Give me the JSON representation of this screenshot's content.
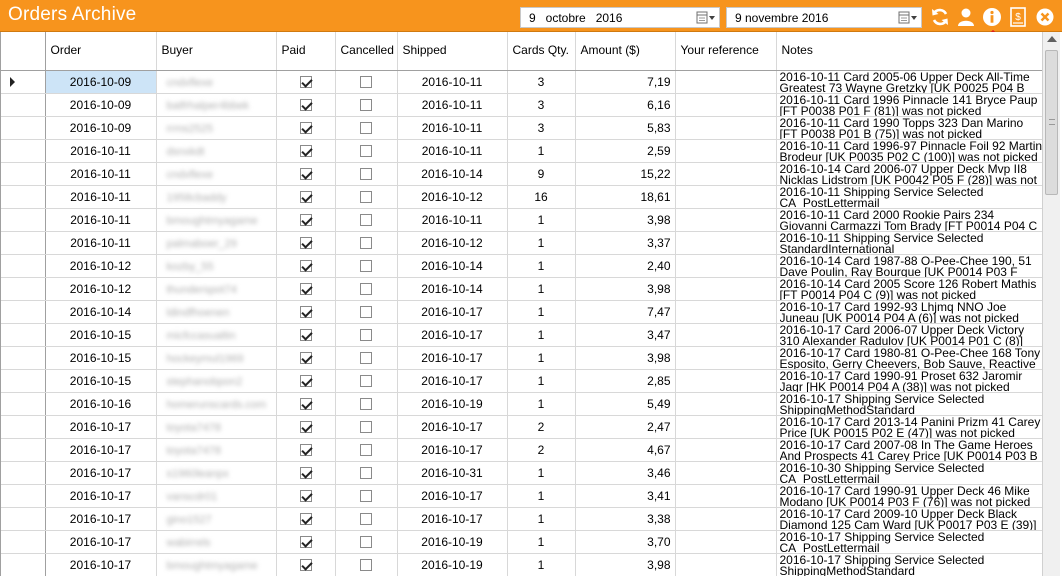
{
  "window": {
    "title": "Orders Archive",
    "date_from": "9   octobre   2016",
    "date_to": "9 novembre 2016",
    "buttons": {
      "refresh": "refresh-icon",
      "user": "user-icon",
      "info": "info-icon",
      "export": "export-icon",
      "close": "close-icon"
    },
    "accent_color": "#f7941d"
  },
  "columns": {
    "order": "Order",
    "buyer": "Buyer",
    "paid": "Paid",
    "cancelled": "Cancelled",
    "shipped": "Shipped",
    "qty": "Cards Qty.",
    "amount": "Amount ($)",
    "reference": "Your reference",
    "notes": "Notes"
  },
  "rows": [
    {
      "order": "2016-10-09",
      "buyer": "cndxflexe",
      "paid": true,
      "cancelled": false,
      "shipped": "2016-10-11",
      "qty": "3",
      "amount": "7,19",
      "notes": "2016-10-11 Card 2005-06 Upper Deck All-Time Greatest 73 Wayne Gretzky [UK P0025 P04 B (82)]"
    },
    {
      "order": "2016-10-09",
      "buyer": "batfrhalper4bbek",
      "paid": true,
      "cancelled": false,
      "shipped": "2016-10-11",
      "qty": "3",
      "amount": "6,16",
      "notes": "2016-10-11 Card 1996 Pinnacle  141 Bryce Paup [FT P0038 P01 F (81)] was not picked"
    },
    {
      "order": "2016-10-09",
      "buyer": "rrms2525",
      "paid": true,
      "cancelled": false,
      "shipped": "2016-10-11",
      "qty": "3",
      "amount": "5,83",
      "notes": "2016-10-11 Card 1990 Topps  323 Dan Marino [FT P0038 P01 B (75)] was not picked"
    },
    {
      "order": "2016-10-11",
      "buyer": "dsnxkdt",
      "paid": true,
      "cancelled": false,
      "shipped": "2016-10-11",
      "qty": "1",
      "amount": "2,59",
      "notes": "2016-10-11 Card 1996-97 Pinnacle Foil  92 Martin Brodeur [UK P0035 P02 C (100)] was not picked"
    },
    {
      "order": "2016-10-11",
      "buyer": "cndxflexe",
      "paid": true,
      "cancelled": false,
      "shipped": "2016-10-14",
      "qty": "9",
      "amount": "15,22",
      "notes": "2016-10-14 Card 2006-07 Upper Deck Mvp  II8 Nicklas Lidstrom [UK P0042 P05 F (28)] was not"
    },
    {
      "order": "2016-10-11",
      "buyer": "1958cbaddy",
      "paid": true,
      "cancelled": false,
      "shipped": "2016-10-12",
      "qty": "16",
      "amount": "18,61",
      "notes": "2016-10-11 Shipping Service Selected CA_PostLettermail"
    },
    {
      "order": "2016-10-11",
      "buyer": "bmoughtmyagame",
      "paid": true,
      "cancelled": false,
      "shipped": "2016-10-11",
      "qty": "1",
      "amount": "3,98",
      "notes": "2016-10-11 Card 2000 Rookie Pairs  234 Giovanni Carmazzi Tom Brady [FT P0014 P04 C (38)] was not"
    },
    {
      "order": "2016-10-11",
      "buyer": "palmaboer_29",
      "paid": true,
      "cancelled": false,
      "shipped": "2016-10-12",
      "qty": "1",
      "amount": "3,37",
      "notes": "2016-10-11 Shipping Service Selected StandardInternational"
    },
    {
      "order": "2016-10-12",
      "buyer": "kozby_55",
      "paid": true,
      "cancelled": false,
      "shipped": "2016-10-14",
      "qty": "1",
      "amount": "2,40",
      "notes": "2016-10-14 Card 1987-88 O-Pee-Chee  190, 51 Dave Poulin, Ray Bourque [UK P0014 P03 F (51)] was not"
    },
    {
      "order": "2016-10-12",
      "buyer": "thunderspot74",
      "paid": true,
      "cancelled": false,
      "shipped": "2016-10-14",
      "qty": "1",
      "amount": "3,98",
      "notes": "2016-10-14 Card 2005 Score  126 Robert Mathis [FT P0014 P04 C (9)] was not picked"
    },
    {
      "order": "2016-10-14",
      "buyer": "ldindfhoenen",
      "paid": true,
      "cancelled": false,
      "shipped": "2016-10-17",
      "qty": "1",
      "amount": "7,47",
      "notes": "2016-10-17 Card 1992-93 Lhjmq  NNO Joe Juneau [UK P0014 P04 A (6)] was not picked"
    },
    {
      "order": "2016-10-15",
      "buyer": "micfccasualtin",
      "paid": true,
      "cancelled": false,
      "shipped": "2016-10-17",
      "qty": "1",
      "amount": "3,47",
      "notes": "2016-10-17 Card 2006-07 Upper Deck Victory  310 Alexander Radulov [UK P0014 P01 C (8)] was not"
    },
    {
      "order": "2016-10-15",
      "buyer": "hockeymul1969",
      "paid": true,
      "cancelled": false,
      "shipped": "2016-10-17",
      "qty": "1",
      "amount": "3,98",
      "notes": "2016-10-17 Card 1980-81 O-Pee-Chee  168 Tony Esposito, Gerry Cheevers, Bob Sauve, Reactive"
    },
    {
      "order": "2016-10-15",
      "buyer": "stephanobpon2",
      "paid": true,
      "cancelled": false,
      "shipped": "2016-10-17",
      "qty": "1",
      "amount": "2,85",
      "notes": "2016-10-17 Card 1990-91 Proset  632 Jaromir Jagr [HK P0014 P04 A (38)] was not picked"
    },
    {
      "order": "2016-10-16",
      "buyer": "homerunscards.com",
      "paid": true,
      "cancelled": false,
      "shipped": "2016-10-19",
      "qty": "1",
      "amount": "5,49",
      "notes": "2016-10-17 Shipping Service Selected ShippingMethodStandard"
    },
    {
      "order": "2016-10-17",
      "buyer": "toyota7478",
      "paid": true,
      "cancelled": false,
      "shipped": "2016-10-17",
      "qty": "2",
      "amount": "2,47",
      "notes": "2016-10-17 Card 2013-14 Panini Prizm  41 Carey Price [UK P0015 P02 E (47)] was not picked"
    },
    {
      "order": "2016-10-17",
      "buyer": "toyota7478",
      "paid": true,
      "cancelled": false,
      "shipped": "2016-10-17",
      "qty": "2",
      "amount": "4,67",
      "notes": "2016-10-17 Card 2007-08 In The Game Heroes And Prospects  41 Carey Price [UK P0014 P03 B (57)] was not"
    },
    {
      "order": "2016-10-17",
      "buyer": "s1960leanpx",
      "paid": true,
      "cancelled": false,
      "shipped": "2016-10-31",
      "qty": "1",
      "amount": "3,46",
      "notes": "2016-10-30 Shipping Service Selected CA_PostLettermail"
    },
    {
      "order": "2016-10-17",
      "buyer": "vanscdr01",
      "paid": true,
      "cancelled": false,
      "shipped": "2016-10-17",
      "qty": "1",
      "amount": "3,41",
      "notes": "2016-10-17 Card 1990-91 Upper Deck  46 Mike Modano [UK P0014 P03 F (76)] was not picked"
    },
    {
      "order": "2016-10-17",
      "buyer": "gino1527",
      "paid": true,
      "cancelled": false,
      "shipped": "2016-10-17",
      "qty": "1",
      "amount": "3,38",
      "notes": "2016-10-17 Card 2009-10 Upper Deck Black Diamond 125 Cam Ward [UK P0017 P03 E (39)] was not picked"
    },
    {
      "order": "2016-10-17",
      "buyer": "wabirrels",
      "paid": true,
      "cancelled": false,
      "shipped": "2016-10-19",
      "qty": "1",
      "amount": "3,70",
      "notes": "2016-10-17 Shipping Service Selected CA_PostLettermail"
    },
    {
      "order": "2016-10-17",
      "buyer": "bmoughtmyagame",
      "paid": true,
      "cancelled": false,
      "shipped": "2016-10-19",
      "qty": "1",
      "amount": "3,98",
      "notes": "2016-10-17 Shipping Service Selected ShippingMethodStandard"
    },
    {
      "order": "2016-10-17",
      "buyer": "fyhmm abrfyz",
      "paid": true,
      "cancelled": false,
      "shipped": "2016-10-19",
      "qty": "1",
      "amount": "2,58",
      "notes": "2016-10-17 Shipping Service Selected"
    }
  ]
}
